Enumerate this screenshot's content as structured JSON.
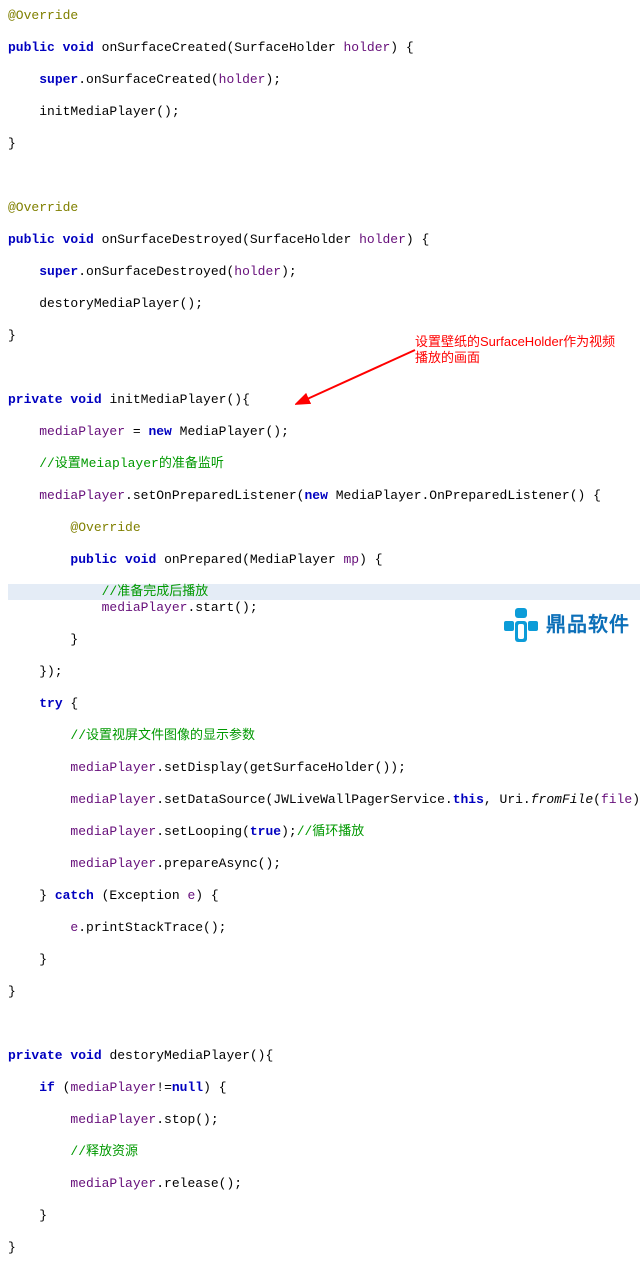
{
  "callout": {
    "text_line1": "设置壁纸的SurfaceHolder作为视频",
    "text_line2": "播放的画面"
  },
  "watermark": {
    "text": "鼎品软件"
  },
  "code": {
    "l01": "@Override",
    "l02_a": "public",
    "l02_b": "void",
    "l02_c": " onSurfaceCreated(SurfaceHolder ",
    "l02_d": "holder",
    "l02_e": ") {",
    "l03_a": "super",
    "l03_b": ".onSurfaceCreated(",
    "l03_c": "holder",
    "l03_d": ");",
    "l04": "    initMediaPlayer();",
    "l05": "}",
    "l06": "",
    "l07": "@Override",
    "l08_a": "public",
    "l08_b": "void",
    "l08_c": " onSurfaceDestroyed(SurfaceHolder ",
    "l08_d": "holder",
    "l08_e": ") {",
    "l09_a": "super",
    "l09_b": ".onSurfaceDestroyed(",
    "l09_c": "holder",
    "l09_d": ");",
    "l10": "    destoryMediaPlayer();",
    "l11": "}",
    "l12": "",
    "l13_a": "private",
    "l13_b": "void",
    "l13_c": " initMediaPlayer(){",
    "l14_a": "mediaPlayer",
    "l14_b": " = ",
    "l14_c": "new",
    "l14_d": " MediaPlayer();",
    "l15": "    //设置Meiaplayer的准备监听",
    "l16_a": "mediaPlayer",
    "l16_b": ".setOnPreparedListener(",
    "l16_c": "new",
    "l16_d": " MediaPlayer.OnPreparedListener() {",
    "l17": "        @Override",
    "l18_a": "public",
    "l18_b": "void",
    "l18_c": " onPrepared(MediaPlayer ",
    "l18_d": "mp",
    "l18_e": ") {",
    "l19": "            //准备完成后播放",
    "l20_a": "mediaPlayer",
    "l20_b": ".start();",
    "l21": "        }",
    "l22": "    });",
    "l23_a": "try",
    "l23_b": " {",
    "l24": "        //设置视屏文件图像的显示参数",
    "l25_a": "mediaPlayer",
    "l25_b": ".setDisplay(getSurfaceHolder());",
    "l26_a": "mediaPlayer",
    "l26_b": ".setDataSource(JWLiveWallPagerService.",
    "l26_c": "this",
    "l26_d": ", Uri.",
    "l26_e": "fromFile",
    "l26_f": "(",
    "l26_g": "file",
    "l26_h": "));",
    "l27_a": "mediaPlayer",
    "l27_b": ".setLooping(",
    "l27_c": "true",
    "l27_d": ");",
    "l27_e": "//循环播放",
    "l28_a": "mediaPlayer",
    "l28_b": ".prepareAsync();",
    "l29_a": "    } ",
    "l29_b": "catch",
    "l29_c": " (Exception ",
    "l29_d": "e",
    "l29_e": ") {",
    "l30_a": "e",
    "l30_b": ".printStackTrace();",
    "l31": "    }",
    "l32": "}",
    "l33": "",
    "l34_a": "private",
    "l34_b": "void",
    "l34_c": " destoryMediaPlayer(){",
    "l35_a": "if",
    "l35_b": " (",
    "l35_c": "mediaPlayer",
    "l35_d": "!=",
    "l35_e": "null",
    "l35_f": ") {",
    "l36_a": "mediaPlayer",
    "l36_b": ".stop();",
    "l37": "        //释放资源",
    "l38_a": "mediaPlayer",
    "l38_b": ".release();",
    "l39": "    }",
    "l40": "}"
  }
}
